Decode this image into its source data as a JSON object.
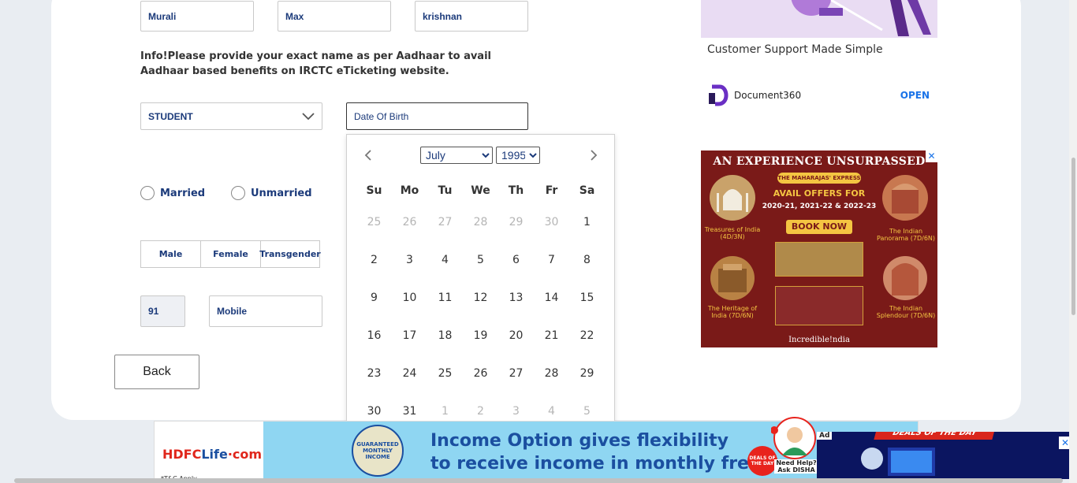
{
  "form": {
    "first_name": "Murali",
    "middle_name": "Max",
    "last_name": "krishnan",
    "info_text": "Info!Please provide your exact name as per Aadhaar to avail Aadhaar based benefits on IRCTC eTicketing website.",
    "occupation": "STUDENT",
    "dob_placeholder": "Date Of Birth",
    "marital": {
      "married": "Married",
      "unmarried": "Unmarried"
    },
    "gender": {
      "male": "Male",
      "female": "Female",
      "transgender": "Transgender"
    },
    "country_code": "91",
    "mobile_placeholder": "Mobile",
    "back_label": "Back"
  },
  "datepicker": {
    "month": "July",
    "year": "1995",
    "weekdays": [
      "Su",
      "Mo",
      "Tu",
      "We",
      "Th",
      "Fr",
      "Sa"
    ],
    "weeks": [
      [
        {
          "d": "25",
          "m": true
        },
        {
          "d": "26",
          "m": true
        },
        {
          "d": "27",
          "m": true
        },
        {
          "d": "28",
          "m": true
        },
        {
          "d": "29",
          "m": true
        },
        {
          "d": "30",
          "m": true
        },
        {
          "d": "1",
          "m": false
        }
      ],
      [
        {
          "d": "2",
          "m": false
        },
        {
          "d": "3",
          "m": false
        },
        {
          "d": "4",
          "m": false
        },
        {
          "d": "5",
          "m": false
        },
        {
          "d": "6",
          "m": false
        },
        {
          "d": "7",
          "m": false
        },
        {
          "d": "8",
          "m": false
        }
      ],
      [
        {
          "d": "9",
          "m": false
        },
        {
          "d": "10",
          "m": false
        },
        {
          "d": "11",
          "m": false
        },
        {
          "d": "12",
          "m": false
        },
        {
          "d": "13",
          "m": false
        },
        {
          "d": "14",
          "m": false
        },
        {
          "d": "15",
          "m": false
        }
      ],
      [
        {
          "d": "16",
          "m": false
        },
        {
          "d": "17",
          "m": false
        },
        {
          "d": "18",
          "m": false
        },
        {
          "d": "19",
          "m": false
        },
        {
          "d": "20",
          "m": false
        },
        {
          "d": "21",
          "m": false
        },
        {
          "d": "22",
          "m": false
        }
      ],
      [
        {
          "d": "23",
          "m": false
        },
        {
          "d": "24",
          "m": false
        },
        {
          "d": "25",
          "m": false
        },
        {
          "d": "26",
          "m": false
        },
        {
          "d": "27",
          "m": false
        },
        {
          "d": "28",
          "m": false
        },
        {
          "d": "29",
          "m": false
        }
      ],
      [
        {
          "d": "30",
          "m": false
        },
        {
          "d": "31",
          "m": false
        },
        {
          "d": "1",
          "m": true
        },
        {
          "d": "2",
          "m": true
        },
        {
          "d": "3",
          "m": true
        },
        {
          "d": "4",
          "m": true
        },
        {
          "d": "5",
          "m": true
        }
      ]
    ]
  },
  "ads": {
    "document360": {
      "title": "Customer Support Made Simple",
      "brand": "Document360",
      "cta": "OPEN"
    },
    "maharajas": {
      "headline": "AN EXPERIENCE UNSURPASSED",
      "ribbon": "THE MAHARAJAS' EXPRESS",
      "offer": "AVAIL OFFERS FOR",
      "years": "2020-21, 2021-22 & 2022-23",
      "cta": "BOOK NOW",
      "captions": [
        "Treasures of India (4D/3N)",
        "The Indian Panorama (7D/6N)",
        "The Heritage of India (7D/6N)",
        "The Indian Splendour (7D/6N)"
      ],
      "footer": "Incredible!ndia"
    },
    "hdfc": {
      "logo_a": "HDFC",
      "logo_b": "Life",
      "logo_c": "·com",
      "line1": "Income Option gives flexibility",
      "line2": "to receive income in monthly frequ",
      "seal": "GUARANTEED MONTHLY INCOME",
      "tc": "*T&C Apply"
    },
    "disha": {
      "help": "Need Help? Ask DISHA",
      "deal": "DEALS OF THE DAY"
    },
    "deals": {
      "label": "Ad",
      "banner": "DEALS OF THE DAY"
    }
  },
  "colors": {
    "accent": "#1b3a7a",
    "link": "#1a73e8",
    "ad_maroon": "#7a1a18",
    "ad_gold": "#f4c542"
  }
}
